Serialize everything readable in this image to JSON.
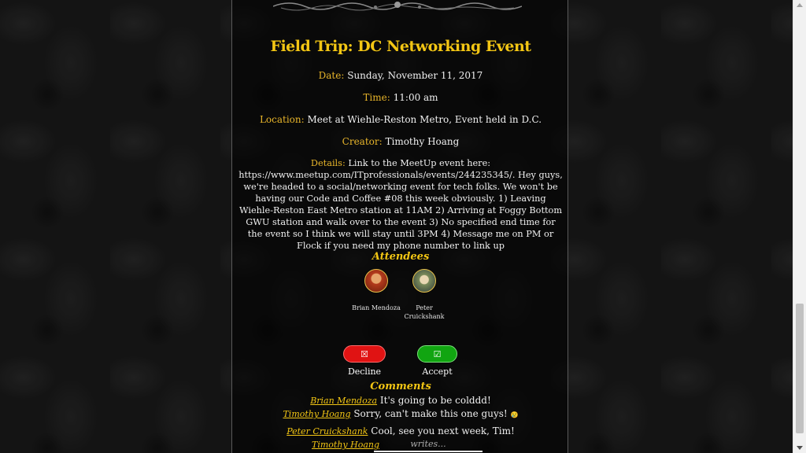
{
  "event": {
    "title": "Field Trip: DC Networking Event",
    "date_label": "Date:",
    "date": "Sunday, November 11, 2017",
    "time_label": "Time:",
    "time": "11:00 am",
    "location_label": "Location:",
    "location": "Meet at Wiehle-Reston Metro, Event held in D.C.",
    "creator_label": "Creator:",
    "creator": "Timothy Hoang",
    "details_label": "Details:",
    "details": "Link to the MeetUp event here: https://www.meetup.com/ITprofessionals/events/244235345/. Hey guys, we're headed to a social/networking event for tech folks. We won't be having our Code and Coffee #08 this week obviously. 1) Leaving Wiehle-Reston East Metro station at 11AM 2) Arriving at Foggy Bottom GWU station and walk over to the event 3) No specified end time for the event so I think we will stay until 3PM 4) Message me on PM or Flock if you need my phone number to link up"
  },
  "attendees": {
    "heading": "Attendees",
    "list": [
      {
        "name": "Brian Mendoza",
        "icon": "avatar-brian"
      },
      {
        "name": "Peter Cruickshank",
        "icon": "avatar-peter"
      }
    ]
  },
  "rsvp": {
    "decline_label": "☒ Decline",
    "accept_label": "☑ Accept",
    "decline_color": "#e01313",
    "accept_color": "#11a511"
  },
  "comments": {
    "heading": "Comments",
    "list": [
      {
        "author": "Brian Mendoza",
        "text": "It's going to be colddd!"
      },
      {
        "author": "Timothy Hoang",
        "text": "Sorry, can't make this one guys!",
        "emoji": "😢"
      },
      {
        "author": "Peter Cruickshank",
        "text": "Cool, see you next week, Tim!"
      }
    ],
    "current_user": "Timothy Hoang",
    "input_placeholder": "writes..."
  },
  "colors": {
    "accent": "#f3c614",
    "label": "#e8b52a",
    "background": "#141414"
  }
}
